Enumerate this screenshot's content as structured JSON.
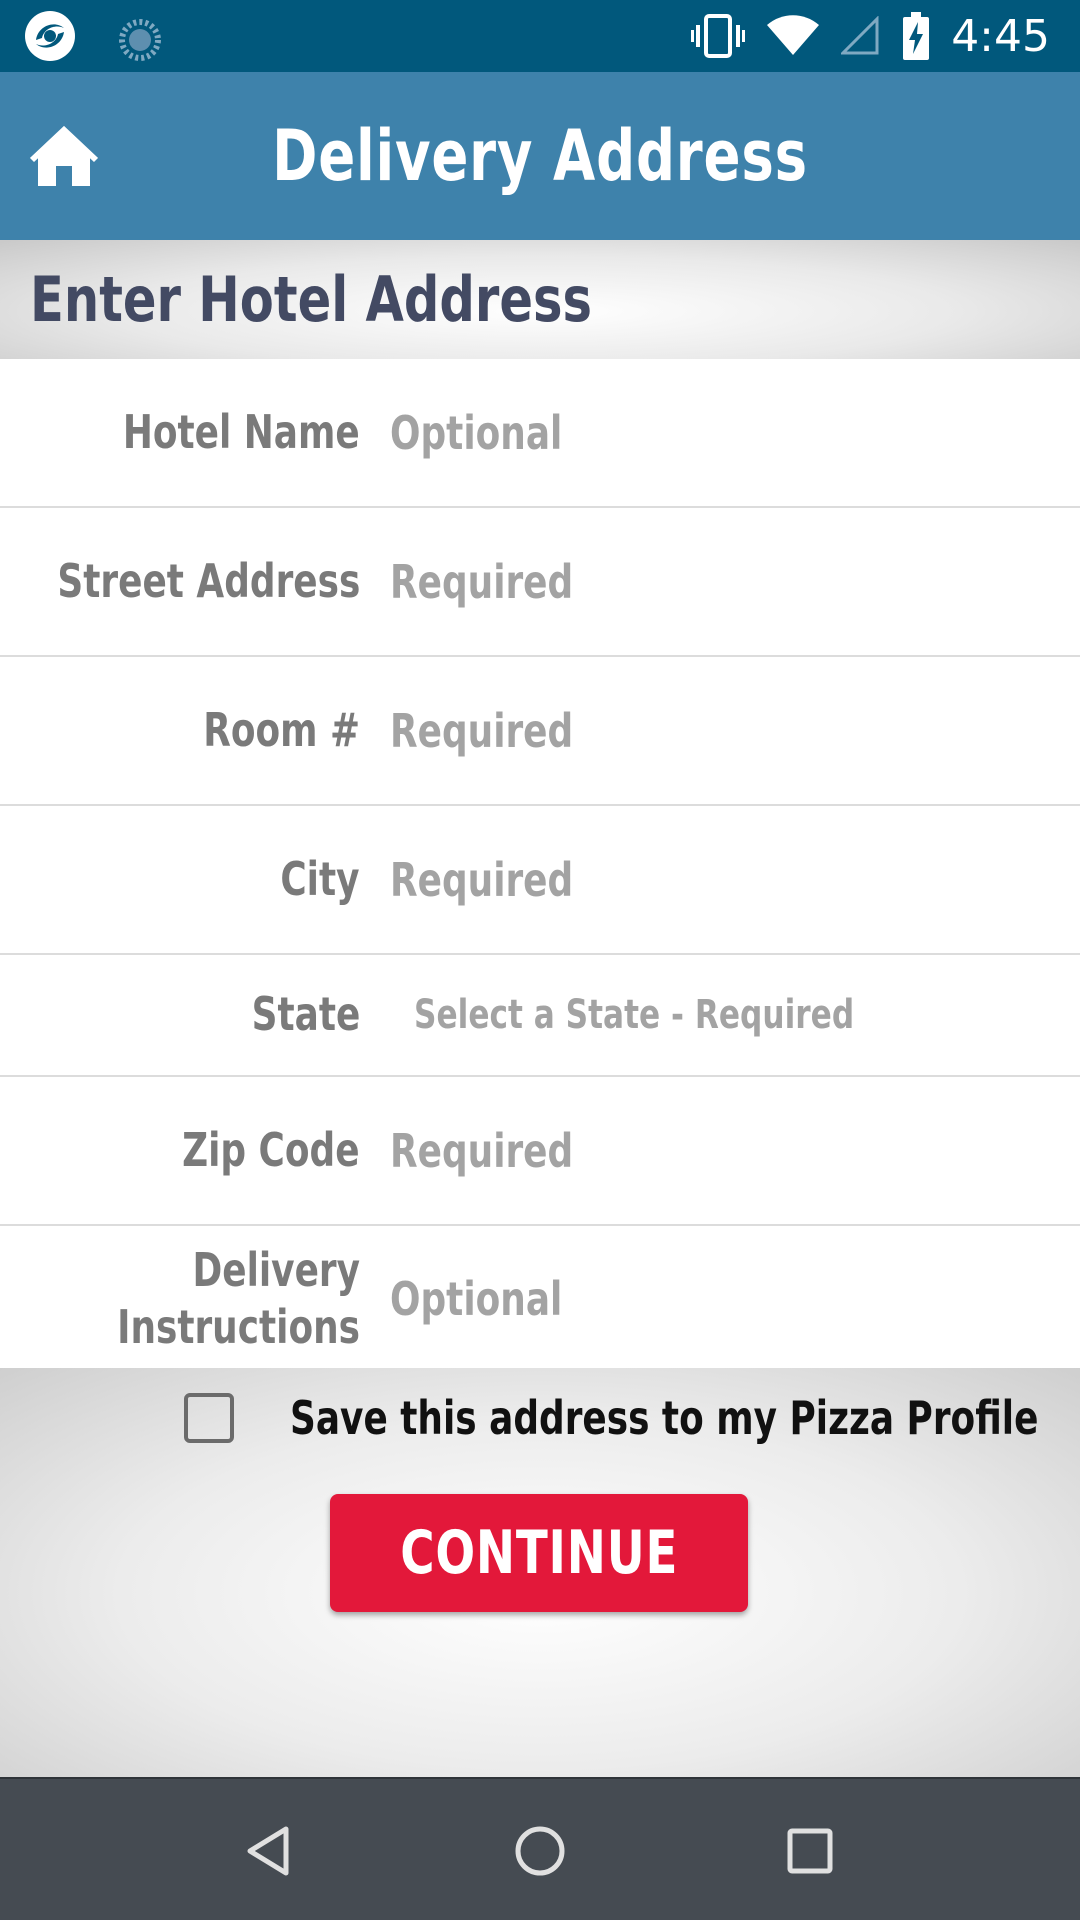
{
  "status_bar": {
    "time": "4:45",
    "icons": [
      "app-logo-icon",
      "sync-icon",
      "vibrate-icon",
      "wifi-icon",
      "signal-icon",
      "battery-charging-icon"
    ]
  },
  "app_bar": {
    "title": "Delivery Address",
    "home_icon": "home-icon"
  },
  "section": {
    "title": "Enter Hotel Address"
  },
  "form": {
    "hotel_name": {
      "label": "Hotel Name",
      "placeholder": "Optional"
    },
    "street_address": {
      "label": "Street Address",
      "placeholder": "Required"
    },
    "room": {
      "label": "Room #",
      "placeholder": "Required"
    },
    "city": {
      "label": "City",
      "placeholder": "Required"
    },
    "state": {
      "label": "State",
      "placeholder": "Select a State - Required"
    },
    "zip": {
      "label": "Zip Code",
      "placeholder": "Required"
    },
    "instructions": {
      "label": "Delivery Instructions",
      "placeholder": "Optional"
    }
  },
  "save": {
    "label": "Save this address to my Pizza Profile",
    "checked": false
  },
  "continue_label": "CONTINUE",
  "nav": {
    "icons": [
      "back-icon",
      "home-circle-icon",
      "recents-icon"
    ]
  },
  "colors": {
    "status_bar": "#01587c",
    "app_bar": "#3e82ab",
    "section_title": "#434a63",
    "continue": "#e3183a",
    "nav_bar": "#454b52"
  }
}
